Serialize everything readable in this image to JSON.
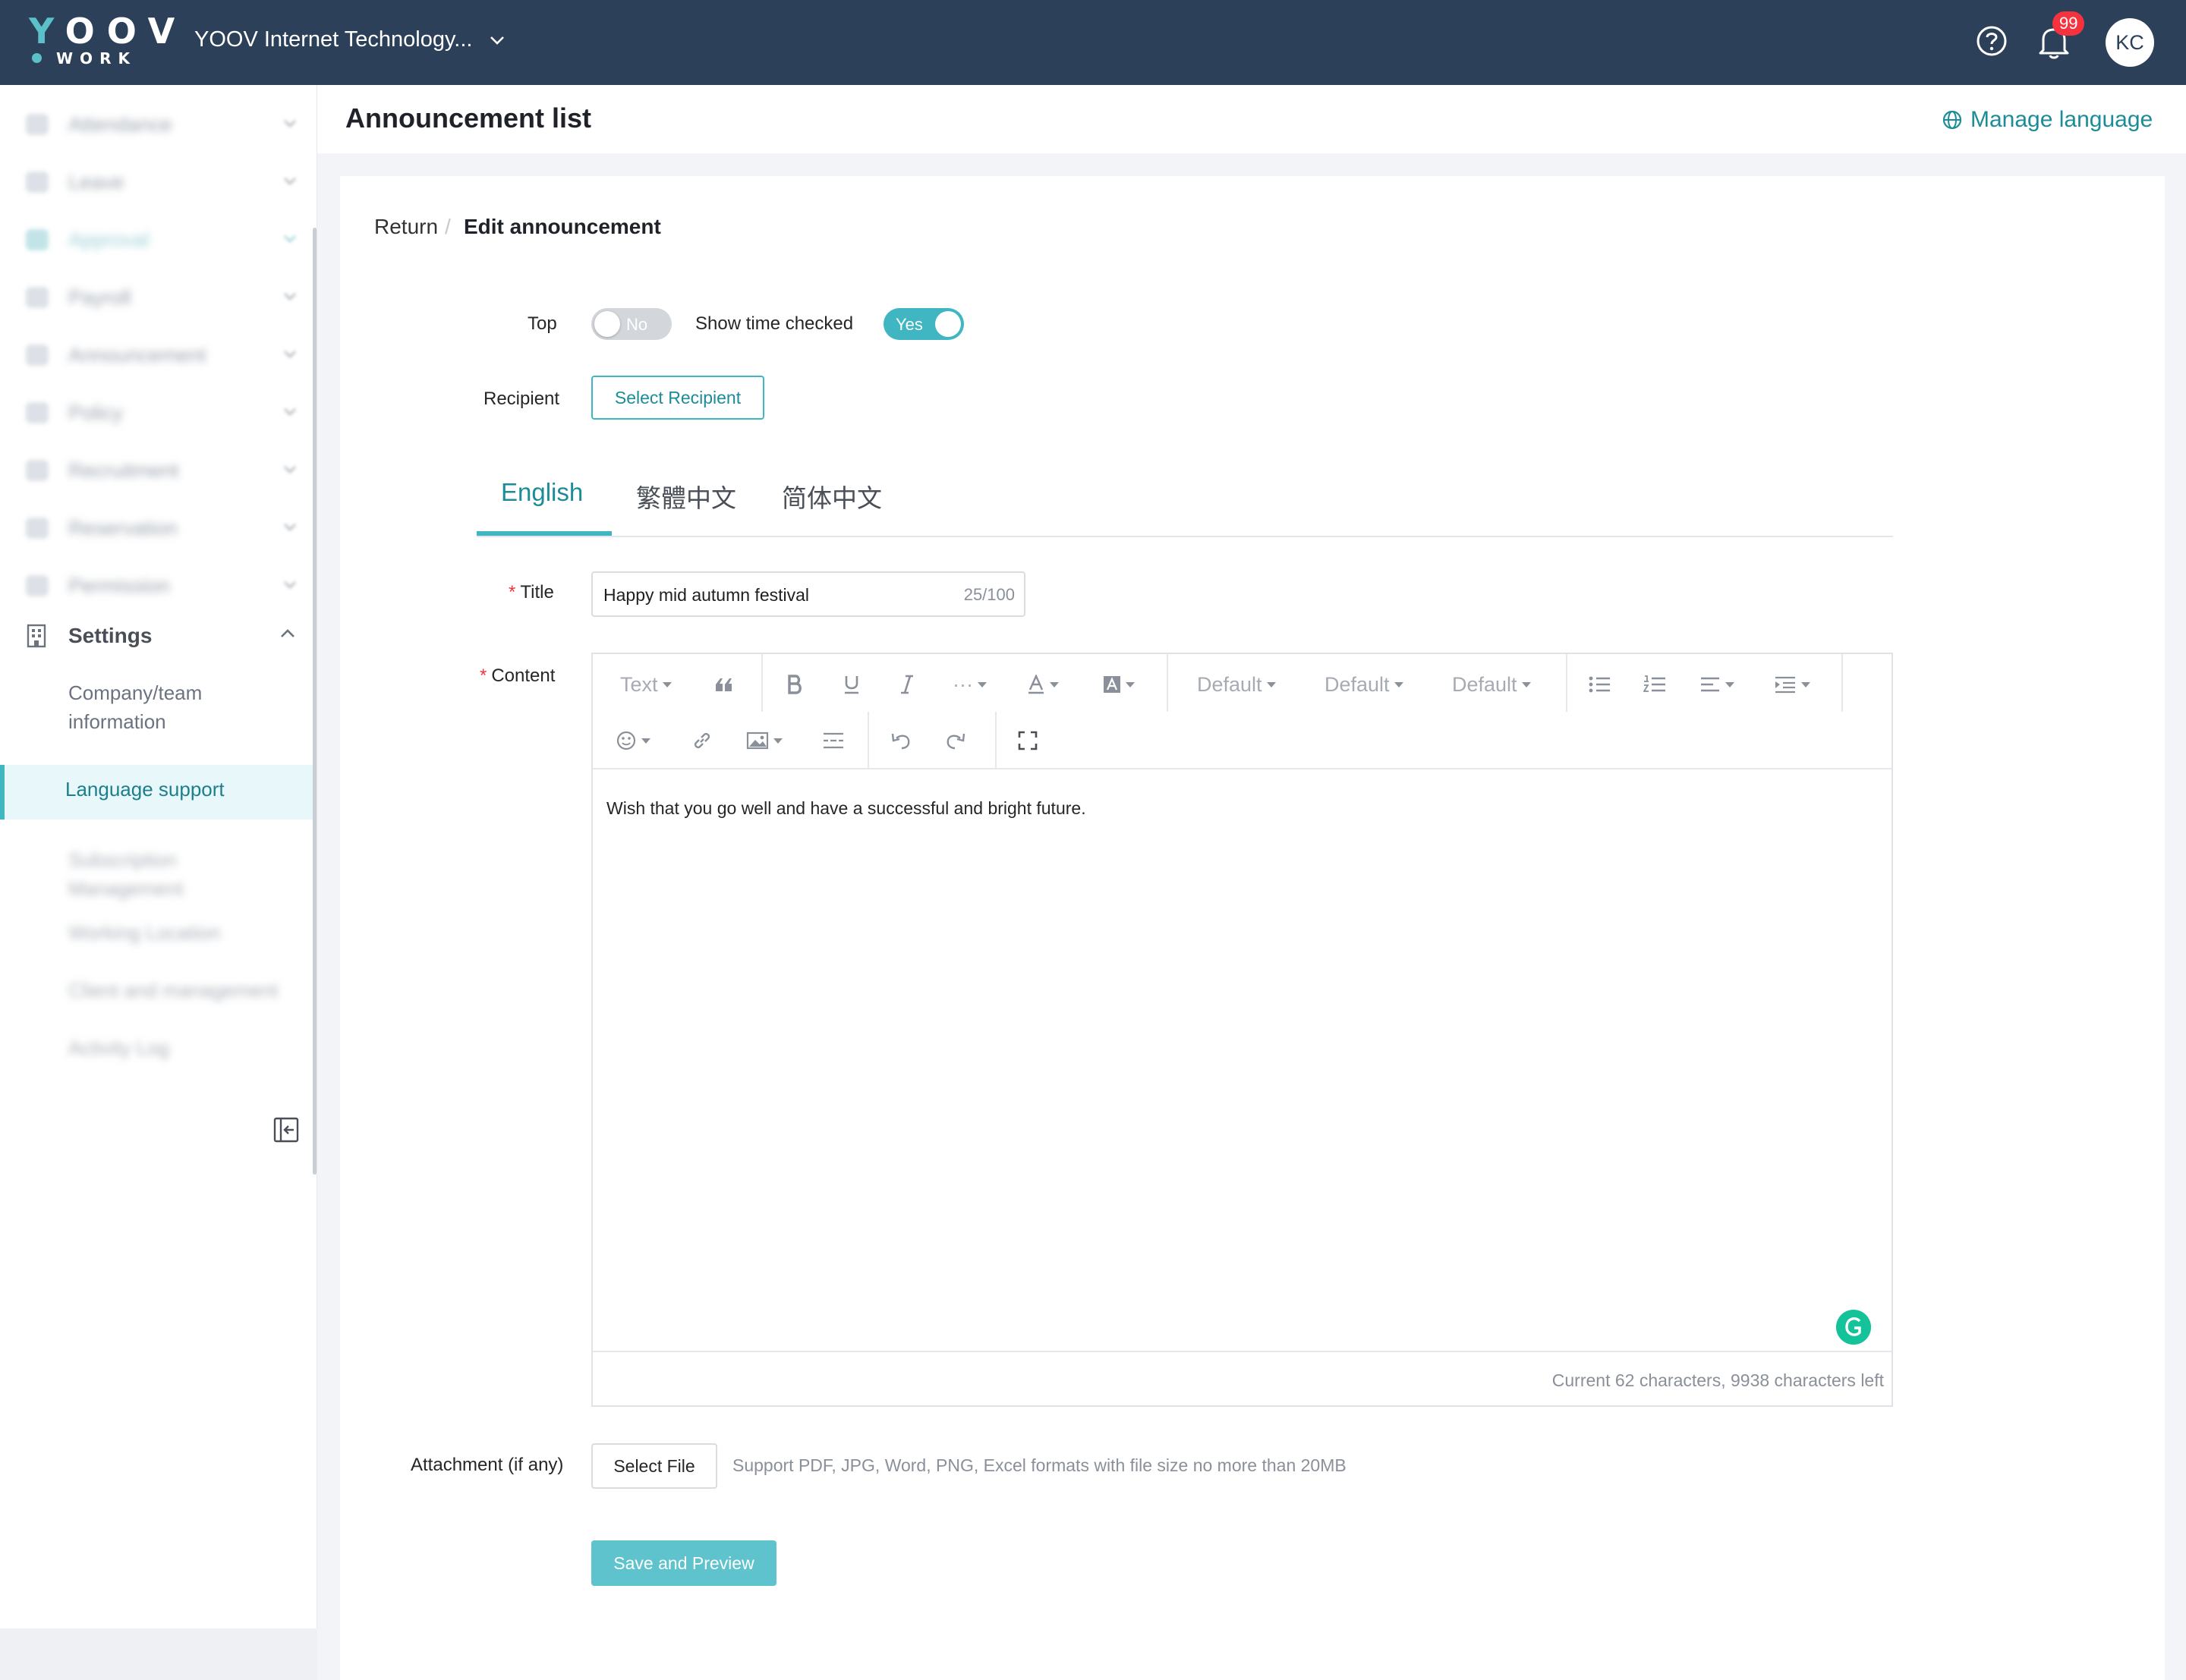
{
  "topbar": {
    "logo_text": "YOOV",
    "logo_sub": "WORK",
    "company": "YOOV Internet Technology...",
    "notifications_badge": "99",
    "avatar_initials": "KC",
    "icons": [
      "help-icon",
      "bell-icon",
      "chevron-down-icon"
    ]
  },
  "sidebar": {
    "items": [
      {
        "label": "Attendance",
        "icon": "clock-icon"
      },
      {
        "label": "Leave",
        "icon": "beach-icon"
      },
      {
        "label": "Approval",
        "icon": "person-icon"
      },
      {
        "label": "Payroll",
        "icon": "money-icon"
      },
      {
        "label": "Announcement",
        "icon": "megaphone-icon"
      },
      {
        "label": "Policy",
        "icon": "document-icon"
      },
      {
        "label": "Recruitment",
        "icon": "briefcase-icon"
      },
      {
        "label": "Reservation",
        "icon": "calendar-icon"
      },
      {
        "label": "Permission",
        "icon": "key-icon"
      }
    ],
    "settings": {
      "label": "Settings",
      "sub_items": [
        {
          "label": "Company/team information"
        },
        {
          "label": "Language support"
        },
        {
          "label": "Subscription Management"
        },
        {
          "label": "Working Location"
        },
        {
          "label": "Client and management"
        },
        {
          "label": "Activity Log"
        }
      ]
    },
    "accent": "#3fb6c2"
  },
  "header": {
    "title": "Announcement list",
    "manage_language": "Manage language"
  },
  "breadcrumb": {
    "return": "Return",
    "separator": "/",
    "current": "Edit announcement"
  },
  "form": {
    "top_label": "Top",
    "top_value": "No",
    "show_time_label": "Show time checked",
    "show_time_value": "Yes",
    "recipient_label": "Recipient",
    "select_recipient": "Select Recipient",
    "tabs": [
      {
        "label": "English",
        "active": true
      },
      {
        "label": "繁體中文",
        "active": false
      },
      {
        "label": "简体中文",
        "active": false
      }
    ],
    "title_label": "Title",
    "title_value": "Happy mid autumn festival",
    "title_count": "25/100",
    "content_label": "Content",
    "content_value": "Wish that you go well and have a successful and bright future.",
    "char_info": "Current 62 characters, 9938 characters left",
    "attachment_label": "Attachment (if any)",
    "select_file": "Select File",
    "file_hint": "Support PDF, JPG, Word, PNG, Excel formats with file size no more than 20MB",
    "save_preview": "Save and Preview"
  },
  "toolbar": {
    "text_label": "Text",
    "font_family": "Default",
    "font_size": "Default",
    "line_height": "Default",
    "more": "···"
  },
  "colors": {
    "topbar": "#2d4059",
    "accent": "#3fb6c2",
    "accent_dark": "#1c8c99",
    "required": "#f5333f",
    "badge": "#f5333f"
  }
}
